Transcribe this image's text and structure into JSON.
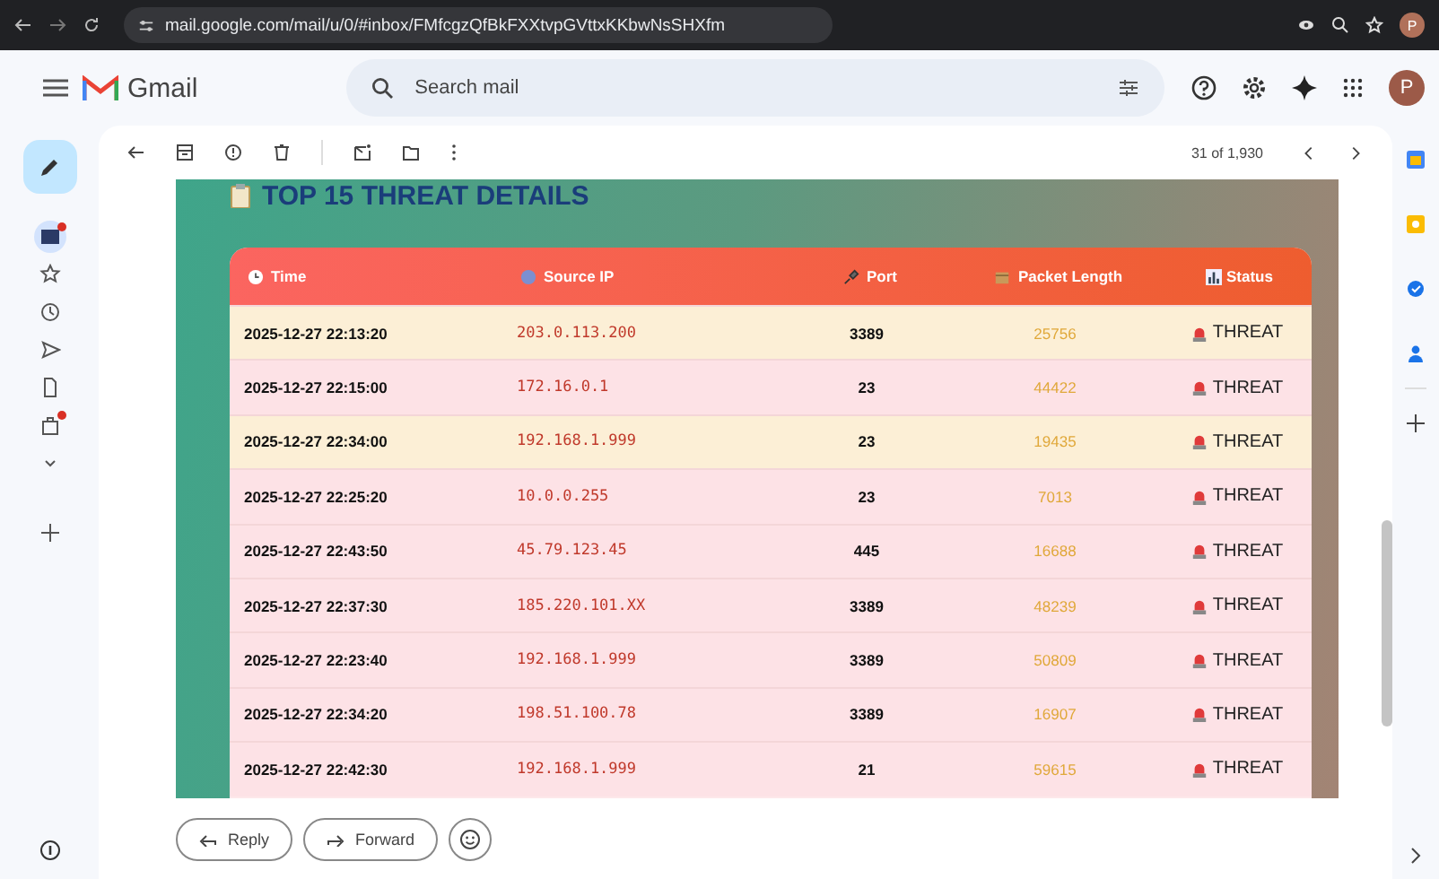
{
  "browser": {
    "url": "mail.google.com/mail/u/0/#inbox/FMfcgzQfBkFXXtvpGVttxKKbwNsSHXfm",
    "profile": "P"
  },
  "app": {
    "name": "Gmail",
    "search_placeholder": "Search mail",
    "avatar": "P"
  },
  "rail": [
    {
      "kind": "inbox",
      "selected": true,
      "dot": true
    },
    {
      "kind": "star",
      "selected": false,
      "dot": false
    },
    {
      "kind": "clock",
      "selected": false,
      "dot": false
    },
    {
      "kind": "send",
      "selected": false,
      "dot": false
    },
    {
      "kind": "doc",
      "selected": false,
      "dot": false
    },
    {
      "kind": "bag",
      "selected": false,
      "dot": true
    },
    {
      "kind": "more",
      "selected": false,
      "dot": false
    }
  ],
  "pager": {
    "count": "31 of 1,930"
  },
  "email": {
    "title": "TOP 15 THREAT DETAILS",
    "columns": [
      {
        "kind": "time",
        "label": "Time"
      },
      {
        "kind": "ip",
        "label": "Source IP"
      },
      {
        "kind": "port",
        "label": "Port"
      },
      {
        "kind": "length",
        "label": "Packet Length"
      },
      {
        "kind": "status",
        "label": "Status"
      }
    ],
    "rows": [
      {
        "time": "2025-12-27 22:13:20",
        "ip": "203.0.113.200",
        "port": "3389",
        "length": "25756",
        "status": "THREAT",
        "highlighted": true
      },
      {
        "time": "2025-12-27 22:15:00",
        "ip": "172.16.0.1",
        "port": "23",
        "length": "44422",
        "status": "THREAT",
        "highlighted": false
      },
      {
        "time": "2025-12-27 22:34:00",
        "ip": "192.168.1.999",
        "port": "23",
        "length": "19435",
        "status": "THREAT",
        "highlighted": true
      },
      {
        "time": "2025-12-27 22:25:20",
        "ip": "10.0.0.255",
        "port": "23",
        "length": "7013",
        "status": "THREAT",
        "highlighted": false
      },
      {
        "time": "2025-12-27 22:43:50",
        "ip": "45.79.123.45",
        "port": "445",
        "length": "16688",
        "status": "THREAT",
        "highlighted": false
      },
      {
        "time": "2025-12-27 22:37:30",
        "ip": "185.220.101.XX",
        "port": "3389",
        "length": "48239",
        "status": "THREAT",
        "highlighted": false
      },
      {
        "time": "2025-12-27 22:23:40",
        "ip": "192.168.1.999",
        "port": "3389",
        "length": "50809",
        "status": "THREAT",
        "highlighted": false
      },
      {
        "time": "2025-12-27 22:34:20",
        "ip": "198.51.100.78",
        "port": "3389",
        "length": "16907",
        "status": "THREAT",
        "highlighted": false
      },
      {
        "time": "2025-12-27 22:42:30",
        "ip": "192.168.1.999",
        "port": "21",
        "length": "59615",
        "status": "THREAT",
        "highlighted": false
      }
    ]
  },
  "actions": [
    {
      "kind": "reply",
      "label": "Reply"
    },
    {
      "kind": "forward",
      "label": "Forward"
    }
  ]
}
